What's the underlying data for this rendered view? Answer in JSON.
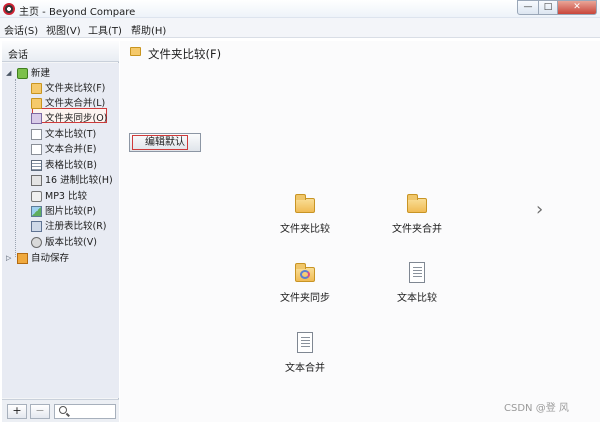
{
  "window": {
    "title": "主页 - Beyond Compare",
    "min_icon": "minimize-icon",
    "max_icon": "maximize-icon",
    "close_icon": "close-icon"
  },
  "menu": [
    "会话(S)",
    "视图(V)",
    "工具(T)",
    "帮助(H)"
  ],
  "sidebar": {
    "header": "会话",
    "new_group": "新建",
    "items": [
      {
        "label": "文件夹比较(F)",
        "icon": "folder-compare-icon",
        "selected": true
      },
      {
        "label": "文件夹合并(L)",
        "icon": "folder-merge-icon"
      },
      {
        "label": "文件夹同步(O)",
        "icon": "folder-sync-icon"
      },
      {
        "label": "文本比较(T)",
        "icon": "text-compare-icon"
      },
      {
        "label": "文本合并(E)",
        "icon": "text-merge-icon"
      },
      {
        "label": "表格比较(B)",
        "icon": "table-compare-icon"
      },
      {
        "label": "16 进制比较(H)",
        "icon": "hex-compare-icon"
      },
      {
        "label": "MP3 比较",
        "icon": "mp3-compare-icon"
      },
      {
        "label": "图片比较(P)",
        "icon": "picture-compare-icon"
      },
      {
        "label": "注册表比较(R)",
        "icon": "registry-compare-icon"
      },
      {
        "label": "版本比较(V)",
        "icon": "version-compare-icon"
      }
    ],
    "autosave": "自动保存",
    "footer": {
      "add": "+",
      "remove": "−"
    }
  },
  "main": {
    "title": "文件夹比较(F)",
    "edit_defaults": "编辑默认",
    "tiles": [
      {
        "label": "文件夹比较",
        "icon": "folder-icon"
      },
      {
        "label": "文件夹合并",
        "icon": "folder-icon"
      },
      {
        "label": "文件夹同步",
        "icon": "folder-sync-icon"
      },
      {
        "label": "文本比较",
        "icon": "document-icon"
      },
      {
        "label": "文本合并",
        "icon": "document-icon"
      }
    ],
    "next": "›"
  },
  "watermark": "CSDN @登 风"
}
